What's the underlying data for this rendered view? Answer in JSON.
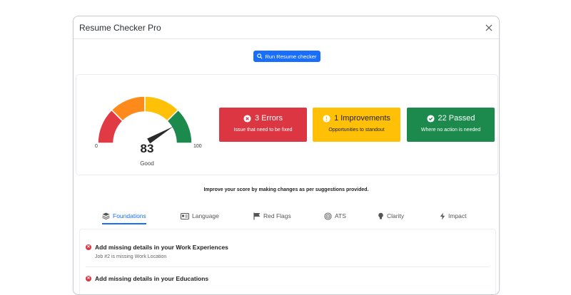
{
  "window": {
    "title": "Resume Checker Pro"
  },
  "run_button": {
    "label": "Run Resume checker"
  },
  "gauge": {
    "score": "83",
    "rating": "Good",
    "min_label": "0",
    "max_label": "100",
    "value": 83,
    "max": 100
  },
  "stats": {
    "errors": {
      "headline": "3 Errors",
      "subtitle": "Issue that need to be fixed",
      "color": "#dd3643"
    },
    "improvements": {
      "headline": "1 Improvements",
      "subtitle": "Opportunities to standout",
      "color": "#ffc007"
    },
    "passed": {
      "headline": "22 Passed",
      "subtitle": "Where no action is needed",
      "color": "#1b8a4c"
    }
  },
  "improve_message": "Improve your score by making changes as per suggestions provided.",
  "tabs": [
    {
      "label": "Foundations",
      "icon": "layers-icon",
      "active": true
    },
    {
      "label": "Language",
      "icon": "id-card-icon",
      "active": false
    },
    {
      "label": "Red Flags",
      "icon": "flag-icon",
      "active": false
    },
    {
      "label": "ATS",
      "icon": "target-icon",
      "active": false
    },
    {
      "label": "Clarity",
      "icon": "lightbulb-icon",
      "active": false
    },
    {
      "label": "Impact",
      "icon": "lightning-icon",
      "active": false
    }
  ],
  "issues": [
    {
      "title": "Add missing details in your Work Experiences",
      "detail": "Job #2 is missing Work Location"
    },
    {
      "title": "Add missing details in your Educations",
      "detail": ""
    }
  ],
  "colors": {
    "accent": "#1a6efc",
    "gauge_red": "#e03a45",
    "gauge_orange": "#fd8a1a",
    "gauge_yellow": "#ffc107",
    "gauge_green": "#1b8a4c"
  }
}
